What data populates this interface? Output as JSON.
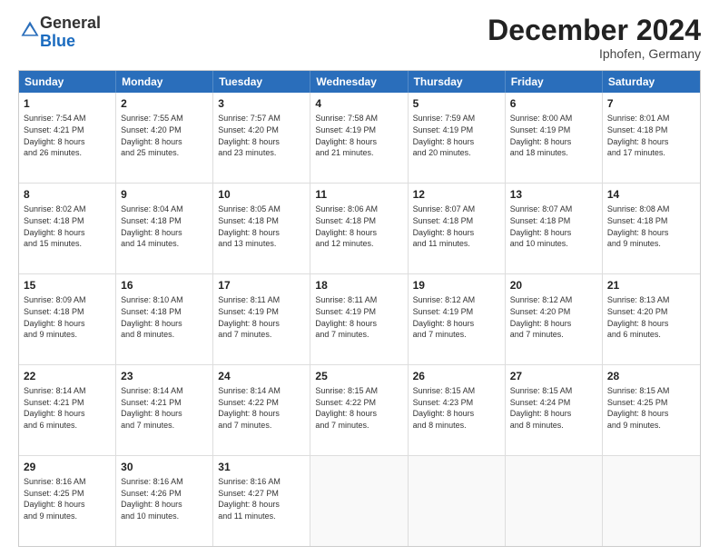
{
  "logo": {
    "general": "General",
    "blue": "Blue"
  },
  "title": "December 2024",
  "subtitle": "Iphofen, Germany",
  "header_days": [
    "Sunday",
    "Monday",
    "Tuesday",
    "Wednesday",
    "Thursday",
    "Friday",
    "Saturday"
  ],
  "weeks": [
    [
      {
        "day": "1",
        "info": "Sunrise: 7:54 AM\nSunset: 4:21 PM\nDaylight: 8 hours\nand 26 minutes."
      },
      {
        "day": "2",
        "info": "Sunrise: 7:55 AM\nSunset: 4:20 PM\nDaylight: 8 hours\nand 25 minutes."
      },
      {
        "day": "3",
        "info": "Sunrise: 7:57 AM\nSunset: 4:20 PM\nDaylight: 8 hours\nand 23 minutes."
      },
      {
        "day": "4",
        "info": "Sunrise: 7:58 AM\nSunset: 4:19 PM\nDaylight: 8 hours\nand 21 minutes."
      },
      {
        "day": "5",
        "info": "Sunrise: 7:59 AM\nSunset: 4:19 PM\nDaylight: 8 hours\nand 20 minutes."
      },
      {
        "day": "6",
        "info": "Sunrise: 8:00 AM\nSunset: 4:19 PM\nDaylight: 8 hours\nand 18 minutes."
      },
      {
        "day": "7",
        "info": "Sunrise: 8:01 AM\nSunset: 4:18 PM\nDaylight: 8 hours\nand 17 minutes."
      }
    ],
    [
      {
        "day": "8",
        "info": "Sunrise: 8:02 AM\nSunset: 4:18 PM\nDaylight: 8 hours\nand 15 minutes."
      },
      {
        "day": "9",
        "info": "Sunrise: 8:04 AM\nSunset: 4:18 PM\nDaylight: 8 hours\nand 14 minutes."
      },
      {
        "day": "10",
        "info": "Sunrise: 8:05 AM\nSunset: 4:18 PM\nDaylight: 8 hours\nand 13 minutes."
      },
      {
        "day": "11",
        "info": "Sunrise: 8:06 AM\nSunset: 4:18 PM\nDaylight: 8 hours\nand 12 minutes."
      },
      {
        "day": "12",
        "info": "Sunrise: 8:07 AM\nSunset: 4:18 PM\nDaylight: 8 hours\nand 11 minutes."
      },
      {
        "day": "13",
        "info": "Sunrise: 8:07 AM\nSunset: 4:18 PM\nDaylight: 8 hours\nand 10 minutes."
      },
      {
        "day": "14",
        "info": "Sunrise: 8:08 AM\nSunset: 4:18 PM\nDaylight: 8 hours\nand 9 minutes."
      }
    ],
    [
      {
        "day": "15",
        "info": "Sunrise: 8:09 AM\nSunset: 4:18 PM\nDaylight: 8 hours\nand 9 minutes."
      },
      {
        "day": "16",
        "info": "Sunrise: 8:10 AM\nSunset: 4:18 PM\nDaylight: 8 hours\nand 8 minutes."
      },
      {
        "day": "17",
        "info": "Sunrise: 8:11 AM\nSunset: 4:19 PM\nDaylight: 8 hours\nand 7 minutes."
      },
      {
        "day": "18",
        "info": "Sunrise: 8:11 AM\nSunset: 4:19 PM\nDaylight: 8 hours\nand 7 minutes."
      },
      {
        "day": "19",
        "info": "Sunrise: 8:12 AM\nSunset: 4:19 PM\nDaylight: 8 hours\nand 7 minutes."
      },
      {
        "day": "20",
        "info": "Sunrise: 8:12 AM\nSunset: 4:20 PM\nDaylight: 8 hours\nand 7 minutes."
      },
      {
        "day": "21",
        "info": "Sunrise: 8:13 AM\nSunset: 4:20 PM\nDaylight: 8 hours\nand 6 minutes."
      }
    ],
    [
      {
        "day": "22",
        "info": "Sunrise: 8:14 AM\nSunset: 4:21 PM\nDaylight: 8 hours\nand 6 minutes."
      },
      {
        "day": "23",
        "info": "Sunrise: 8:14 AM\nSunset: 4:21 PM\nDaylight: 8 hours\nand 7 minutes."
      },
      {
        "day": "24",
        "info": "Sunrise: 8:14 AM\nSunset: 4:22 PM\nDaylight: 8 hours\nand 7 minutes."
      },
      {
        "day": "25",
        "info": "Sunrise: 8:15 AM\nSunset: 4:22 PM\nDaylight: 8 hours\nand 7 minutes."
      },
      {
        "day": "26",
        "info": "Sunrise: 8:15 AM\nSunset: 4:23 PM\nDaylight: 8 hours\nand 8 minutes."
      },
      {
        "day": "27",
        "info": "Sunrise: 8:15 AM\nSunset: 4:24 PM\nDaylight: 8 hours\nand 8 minutes."
      },
      {
        "day": "28",
        "info": "Sunrise: 8:15 AM\nSunset: 4:25 PM\nDaylight: 8 hours\nand 9 minutes."
      }
    ],
    [
      {
        "day": "29",
        "info": "Sunrise: 8:16 AM\nSunset: 4:25 PM\nDaylight: 8 hours\nand 9 minutes."
      },
      {
        "day": "30",
        "info": "Sunrise: 8:16 AM\nSunset: 4:26 PM\nDaylight: 8 hours\nand 10 minutes."
      },
      {
        "day": "31",
        "info": "Sunrise: 8:16 AM\nSunset: 4:27 PM\nDaylight: 8 hours\nand 11 minutes."
      },
      {
        "day": "",
        "info": ""
      },
      {
        "day": "",
        "info": ""
      },
      {
        "day": "",
        "info": ""
      },
      {
        "day": "",
        "info": ""
      }
    ]
  ]
}
